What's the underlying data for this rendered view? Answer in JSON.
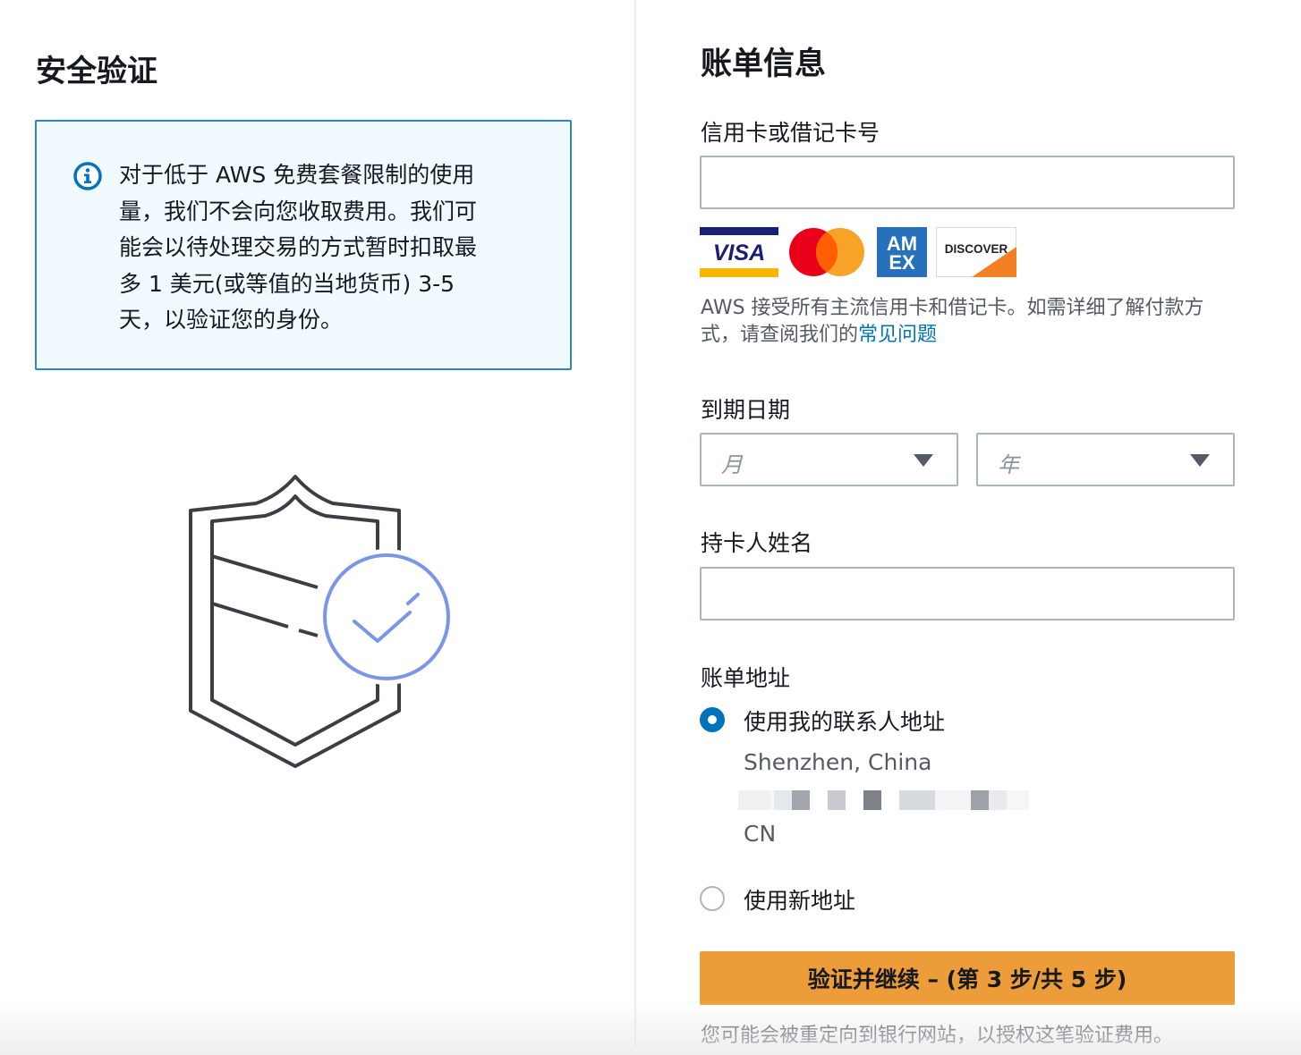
{
  "left": {
    "title": "安全验证",
    "info": {
      "lines": [
        "对于低于 AWS 免费套餐限制的使用",
        "量，我们不会向您收取费用。我们可",
        "能会以待处理交易的方式暂时扣取最",
        "多 1 美元(或等值的当地货币) 3-5",
        "天，以验证您的身份。"
      ],
      "icon": "info-icon"
    },
    "illustration": "shield-check-icon"
  },
  "right": {
    "title": "账单信息",
    "card_number": {
      "label": "信用卡或借记卡号",
      "value": "",
      "placeholder": ""
    },
    "card_logos": {
      "visa": "VISA",
      "mastercard": "mastercard",
      "amex_top": "AM",
      "amex_bottom": "EX",
      "discover": "DISCOVER"
    },
    "help_text": "AWS 接受所有主流信用卡和借记卡。如需详细了解付款方式，请查阅我们的",
    "help_link": "常见问题",
    "expiry": {
      "label": "到期日期",
      "month_placeholder": "月",
      "year_placeholder": "年"
    },
    "cardholder": {
      "label": "持卡人姓名",
      "value": ""
    },
    "billing_address": {
      "label": "账单地址",
      "option_contact": "使用我的联系人地址",
      "contact_city": "Shenzhen, China",
      "contact_country": "CN",
      "option_new": "使用新地址"
    },
    "submit_label": "验证并继续 – (第 3 步/共 5 步)",
    "footnote": "您可能会被重定向到银行网站，以授权这笔验证费用。"
  },
  "colors": {
    "accent": "#0073bb",
    "info_border": "#3184c2",
    "info_bg": "#f1faff",
    "primary_button": "#ec9d3a",
    "illustration_blue": "#7b96e8"
  }
}
